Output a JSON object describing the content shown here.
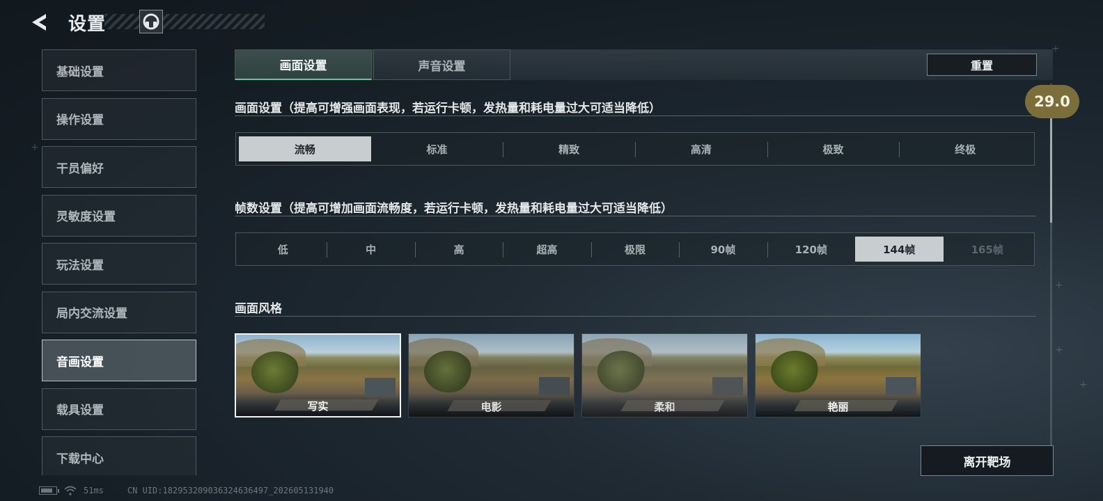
{
  "header": {
    "title": "设置"
  },
  "sidebar": {
    "items": [
      {
        "label": "基础设置",
        "active": false
      },
      {
        "label": "操作设置",
        "active": false
      },
      {
        "label": "干员偏好",
        "active": false
      },
      {
        "label": "灵敏度设置",
        "active": false
      },
      {
        "label": "玩法设置",
        "active": false
      },
      {
        "label": "局内交流设置",
        "active": false
      },
      {
        "label": "音画设置",
        "active": true
      },
      {
        "label": "载具设置",
        "active": false
      },
      {
        "label": "下载中心",
        "active": false
      }
    ]
  },
  "tabs": [
    {
      "label": "画面设置",
      "active": true
    },
    {
      "label": "声音设置",
      "active": false
    }
  ],
  "reset_label": "重置",
  "quality": {
    "title": "画面设置（提高可增强画面表现，若运行卡顿，发热量和耗电量过大可适当降低）",
    "options": [
      "流畅",
      "标准",
      "精致",
      "高清",
      "极致",
      "终极"
    ],
    "selected": "流畅"
  },
  "framerate": {
    "title": "帧数设置（提高可增加画面流畅度，若运行卡顿，发热量和耗电量过大可适当降低）",
    "options": [
      "低",
      "中",
      "高",
      "超高",
      "极限",
      "90帧",
      "120帧",
      "144帧",
      "165帧"
    ],
    "selected": "144帧",
    "disabled": [
      "165帧"
    ]
  },
  "style": {
    "title": "画面风格",
    "options": [
      "写实",
      "电影",
      "柔和",
      "艳丽"
    ],
    "selected": "写实"
  },
  "fps_badge": "29.0",
  "leave_label": "离开靶场",
  "status": {
    "ping": "51ms",
    "uid": "CN UID:1829532090363246364​97_202605131940"
  }
}
